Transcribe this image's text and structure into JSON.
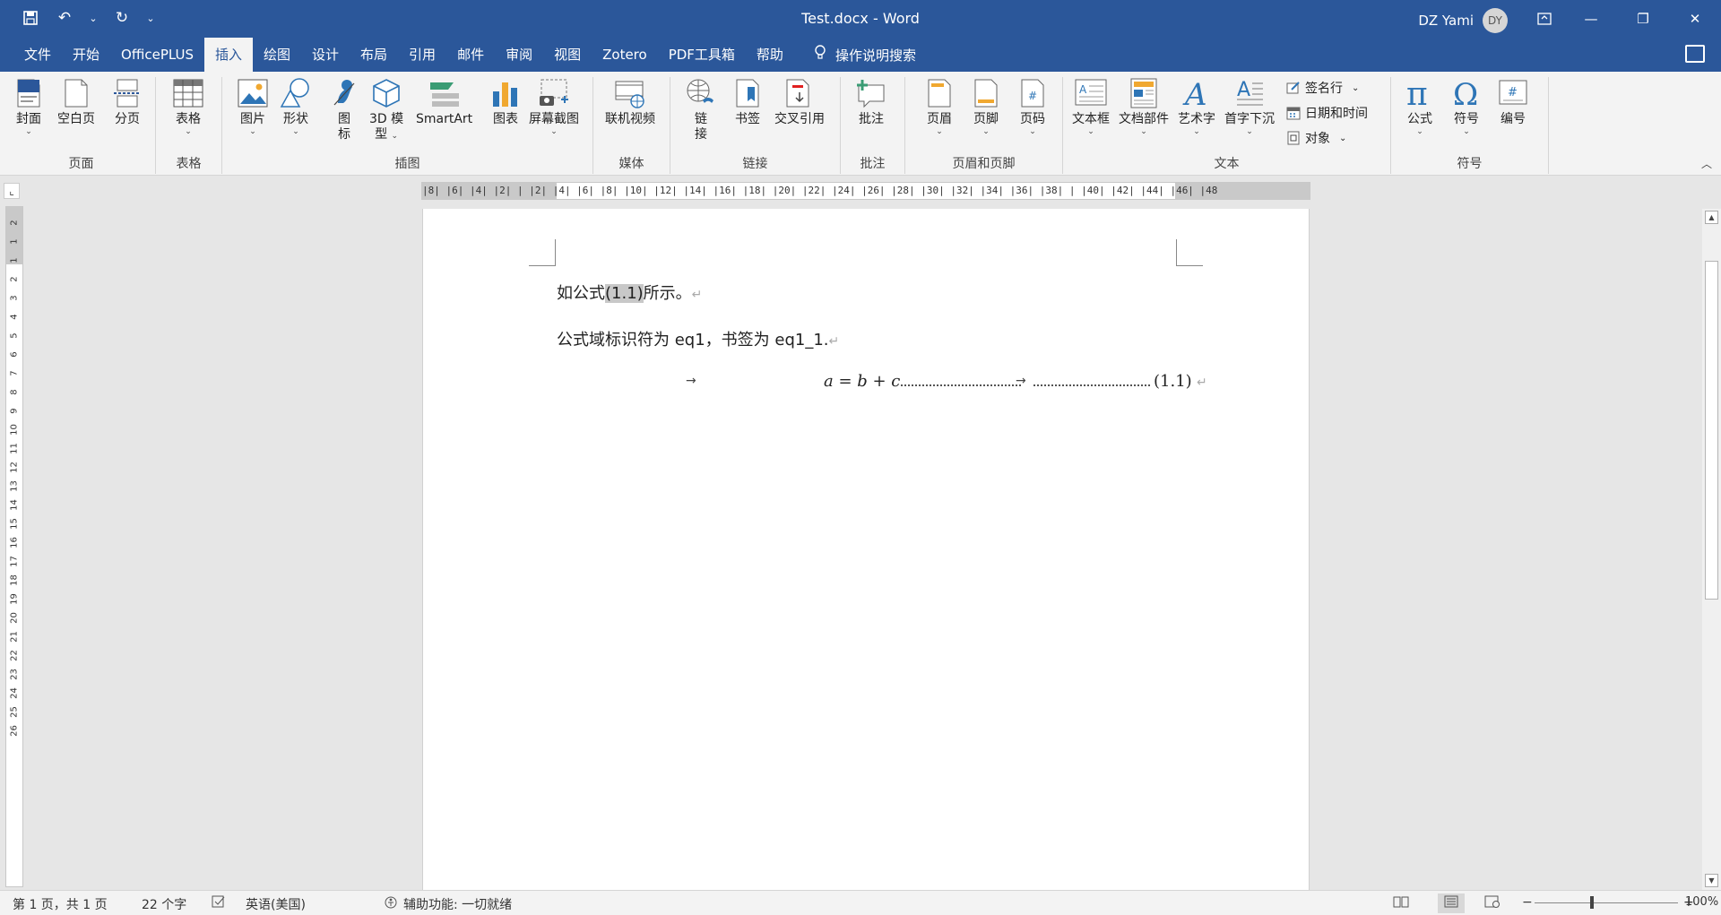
{
  "app": {
    "doc_title": "Test.docx  -  Word",
    "user_name": "DZ Yami",
    "user_initials": "DY"
  },
  "colors": {
    "brand": "#2b579a",
    "ribbon_bg": "#f3f3f3",
    "highlight": "#c8c8c8"
  },
  "qat": {
    "save": "save-icon",
    "undo": "undo-icon",
    "redo": "redo-icon"
  },
  "tabs": [
    {
      "label": "文件"
    },
    {
      "label": "开始"
    },
    {
      "label": "OfficePLUS"
    },
    {
      "label": "插入"
    },
    {
      "label": "绘图"
    },
    {
      "label": "设计"
    },
    {
      "label": "布局"
    },
    {
      "label": "引用"
    },
    {
      "label": "邮件"
    },
    {
      "label": "审阅"
    },
    {
      "label": "视图"
    },
    {
      "label": "Zotero"
    },
    {
      "label": "PDF工具箱"
    },
    {
      "label": "帮助"
    }
  ],
  "active_tab": "插入",
  "tell_me": "操作说明搜索",
  "ribbon": {
    "pages": {
      "label": "页面",
      "cover": "封面",
      "blank": "空白页",
      "break": "分页"
    },
    "tables": {
      "label": "表格",
      "table": "表格"
    },
    "illustrations": {
      "label": "插图",
      "picture": "图片",
      "shapes": "形状",
      "icons_l1": "图",
      "icons_l2": "标",
      "model_l1": "3D 模",
      "model_l2": "型",
      "smartart": "SmartArt",
      "chart": "图表",
      "screenshot": "屏幕截图"
    },
    "media": {
      "label": "媒体",
      "video": "联机视频"
    },
    "links": {
      "label": "链接",
      "link_l1": "链",
      "link_l2": "接",
      "bookmark": "书签",
      "crossref": "交叉引用"
    },
    "comments": {
      "label": "批注",
      "comment": "批注"
    },
    "header_footer": {
      "label": "页眉和页脚",
      "header": "页眉",
      "footer": "页脚",
      "page_number": "页码"
    },
    "text": {
      "label": "文本",
      "textbox": "文本框",
      "quickparts": "文档部件",
      "wordart": "艺术字",
      "dropcap": "首字下沉",
      "signature": "签名行",
      "datetime": "日期和时间",
      "object": "对象"
    },
    "symbols": {
      "label": "符号",
      "equation": "公式",
      "symbol": "符号",
      "numbering": "编号"
    }
  },
  "ruler": {
    "h_ticks": "|8|  |6|  |4|  |2|  |   |2|  |4|  |6|  |8|  |10|  |12|  |14|  |16|  |18|  |20|  |22|  |24|  |26|  |28|  |30|  |32|  |34|  |36|  |38|  |  |40|  |42|  |44|  |46|  |48",
    "v_ticks": [
      "2",
      "1",
      "1",
      "2",
      "3",
      "4",
      "5",
      "6",
      "7",
      "8",
      "9",
      "10",
      "11",
      "12",
      "13",
      "14",
      "15",
      "16",
      "17",
      "18",
      "19",
      "20",
      "21",
      "22",
      "23",
      "24",
      "25",
      "26"
    ]
  },
  "document": {
    "p1_before": "如公式",
    "p1_field": "(1.1)",
    "p1_after": "所示。",
    "p2": "公式域标识符为 eq1，书签为 eq1_1.",
    "equation": "a = b + c",
    "equation_number": "(1.1)",
    "tab_arrow": "→",
    "para_mark": "↵"
  },
  "status": {
    "page": "第 1 页，共 1 页",
    "words": "22 个字",
    "language": "英语(美国)",
    "accessibility": "辅助功能: 一切就绪",
    "zoom": "100%"
  }
}
